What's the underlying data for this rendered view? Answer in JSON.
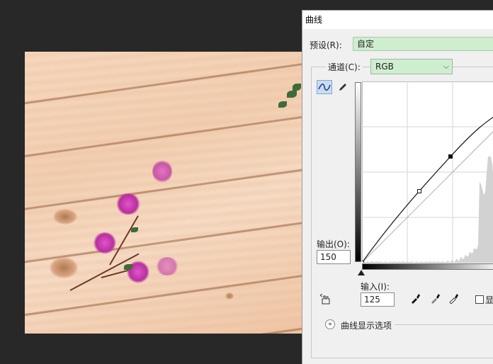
{
  "dialog": {
    "title": "曲线",
    "preset_label": "预设(R):",
    "preset_value": "自定",
    "channel_label": "通道(C):",
    "channel_value": "RGB",
    "output_label": "输出(O):",
    "output_value": "150",
    "input_label": "输入(I):",
    "input_value": "125",
    "show_label": "显",
    "display_options_label": "曲线显示选项"
  },
  "colors": {
    "preset_bg": "#cfeecf",
    "panel_bg": "#f0f0f0",
    "workspace_bg": "#282828"
  },
  "icons": [
    "curve-tool-icon",
    "pencil-icon",
    "hand-adjust-icon",
    "black-eyedropper-icon",
    "gray-eyedropper-icon",
    "white-eyedropper-icon",
    "chevron-down-icon",
    "expand-icon"
  ]
}
